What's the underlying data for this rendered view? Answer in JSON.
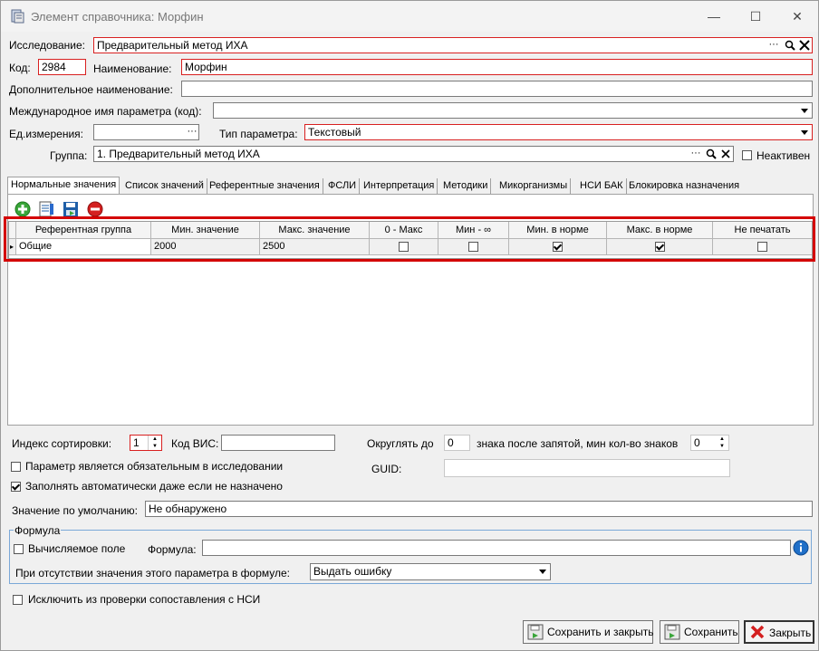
{
  "window": {
    "title": "Элемент справочника: Морфин",
    "minimize_glyph": "—",
    "maximize_glyph": "☐",
    "close_glyph": "✕"
  },
  "header": {
    "research_label": "Исследование:",
    "research_value": "Предварительный метод ИХА",
    "code_label": "Код:",
    "code_value": "2984",
    "name_label": "Наименование:",
    "name_value": "Морфин",
    "extra_name_label": "Дополнительное наименование:",
    "extra_name_value": "",
    "intl_name_label": "Международное имя параметра (код):",
    "intl_name_value": "",
    "unit_label": "Ед.измерения:",
    "unit_value": "",
    "param_type_label": "Тип параметра:",
    "param_type_value": "Текстовый",
    "group_label": "Группа:",
    "group_value": "1. Предварительный метод ИХА",
    "inactive_label": "Неактивен",
    "inactive_checked": false,
    "ellipsis": "···",
    "search_glyph": "🔍",
    "clear_glyph": "✕"
  },
  "tabs": [
    {
      "label": "Нормальные значения",
      "active": true
    },
    {
      "label": "Список значений",
      "active": false
    },
    {
      "label": "Референтные значения",
      "active": false
    },
    {
      "label": "ФСЛИ",
      "active": false
    },
    {
      "label": "Интерпретация",
      "active": false
    },
    {
      "label": "Методики",
      "active": false
    },
    {
      "label": "Микорганизмы",
      "active": false
    },
    {
      "label": "НСИ БАК",
      "active": false
    },
    {
      "label": "Блокировка назначения",
      "active": false
    }
  ],
  "toolbar": {
    "icons": [
      "add-icon",
      "edit-list-icon",
      "save-row-icon",
      "delete-icon"
    ],
    "colors": {
      "add": "#3aa53a",
      "delete": "#d42020",
      "save": "#1f5fa8"
    }
  },
  "grid": {
    "columns": [
      "Референтная группа",
      "Мин. значение",
      "Макс. значение",
      "0 - Макс",
      "Мин - ∞",
      "Мин. в норме",
      "Макс. в норме",
      "Не печатать"
    ],
    "rows": [
      {
        "group": "Общие",
        "min": "2000",
        "max": "2500",
        "zero_max": false,
        "min_inf": false,
        "min_in_norm": true,
        "max_in_norm": true,
        "no_print": false
      }
    ]
  },
  "bottom": {
    "sort_index_label": "Индекс сортировки:",
    "sort_index_value": "1",
    "vis_code_label": "Код ВИС:",
    "vis_code_value": "",
    "round_label": "Округлять до",
    "round_value": "0",
    "decimals_label": "знака после запятой, мин кол-во знаков",
    "min_digits_value": "0",
    "required_label": "Параметр является обязательным в исследовании",
    "required_checked": false,
    "guid_label": "GUID:",
    "guid_value": "",
    "autofill_label": "Заполнять автоматически даже если не назначено",
    "autofill_checked": true,
    "default_label": "Значение по умолчанию:",
    "default_value": "Не обнаружено"
  },
  "formula": {
    "group_title": "Формула",
    "computed_label": "Вычисляемое поле",
    "computed_checked": false,
    "formula_label": "Формула:",
    "formula_value": "",
    "missing_label": "При отсутствии значения этого параметра в формуле:",
    "missing_value": "Выдать ошибку",
    "info_glyph": "i"
  },
  "exclude": {
    "label": "Исключить из проверки сопоставления с НСИ",
    "checked": false
  },
  "buttons": {
    "save_close": "Сохранить и закрыть",
    "save": "Сохранить",
    "close": "Закрыть"
  }
}
